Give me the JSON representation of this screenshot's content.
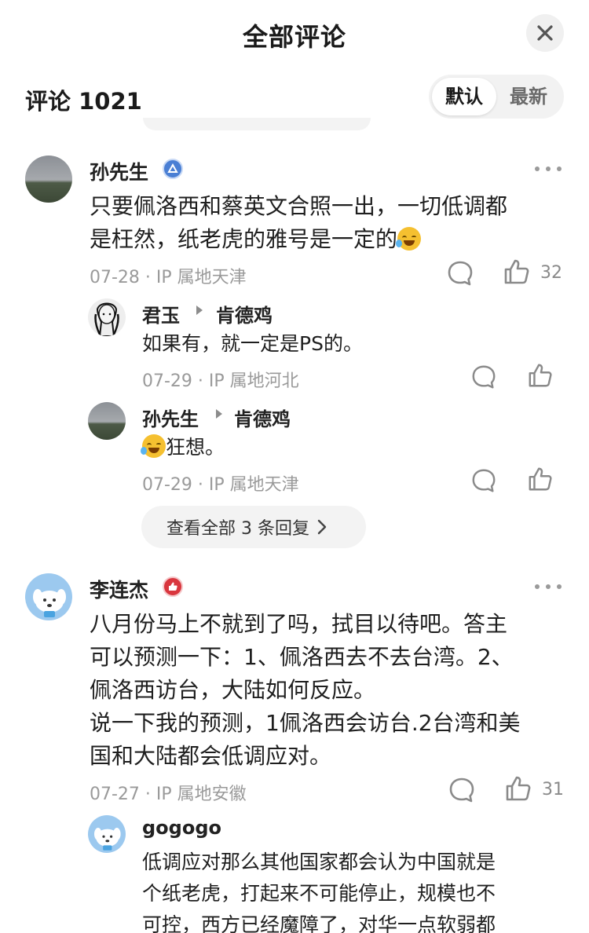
{
  "header": {
    "title": "全部评论"
  },
  "comments_header": {
    "count_label": "评论 1021"
  },
  "sort": {
    "default_label": "默认",
    "newest_label": "最新"
  },
  "comments": [
    {
      "author": "孙先生",
      "badge": "blue-triangle-badge",
      "text_lines": [
        "只要佩洛西和蔡英文合照一出，一切低调都",
        "是枉然，纸老虎的雅号是一定的"
      ],
      "has_emoji": "laugh-cry-emoji",
      "meta": "07-28 · IP 属地天津",
      "likes": "32",
      "replies": [
        {
          "author": "君玉",
          "reply_to": "肯德鸡",
          "text": "如果有，就一定是PS的。",
          "meta": "07-29 · IP 属地河北"
        },
        {
          "author": "孙先生",
          "reply_to": "肯德鸡",
          "text": "狂想。",
          "meta": "07-29 · IP 属地天津"
        }
      ],
      "view_all": "查看全部 3 条回复"
    },
    {
      "author": "李连杰",
      "badge": "red-thumb-badge",
      "text_lines": [
        "八月份马上不就到了吗，拭目以待吧。答主",
        "可以预测一下：1、佩洛西去不去台湾。2、",
        "佩洛西访台，大陆如何反应。",
        "说一下我的预测，1佩洛西会访台.2台湾和美",
        "国和大陆都会低调应对。"
      ],
      "meta": "07-27 · IP 属地安徽",
      "likes": "31",
      "replies": [
        {
          "author": "gogogo",
          "text_lines": [
            "低调应对那么其他国家都会认为中国就是",
            "个纸老虎，打起来不可能停止，规模也不",
            "可控，西方已经魔障了，对华一点软弱都"
          ]
        }
      ]
    }
  ],
  "colors": {
    "text": "#1f1f1f",
    "muted": "#9a9a9a",
    "pill": "#f3f3f3",
    "badge_blue": "#4a7fd4",
    "badge_red": "#d9363e"
  }
}
